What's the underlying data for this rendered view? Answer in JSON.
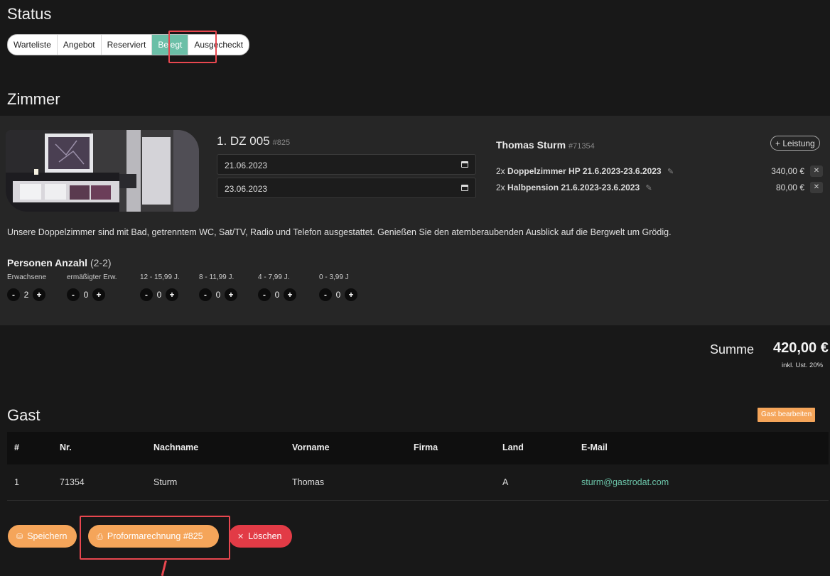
{
  "status": {
    "title": "Status",
    "segments": [
      "Warteliste",
      "Angebot",
      "Reserviert",
      "Belegt",
      "Ausgecheckt"
    ],
    "active": "Belegt",
    "accent": "#6bbfa7"
  },
  "zimmer": {
    "title": "Zimmer",
    "room_name": "1. DZ 005",
    "room_ref": "#825",
    "arrival": "21.06.2023",
    "departure": "23.06.2023",
    "guest_name": "Thomas Sturm",
    "guest_ref": "#71354",
    "add_service_label": "+ Leistung",
    "services": [
      {
        "qty": "2x",
        "title": "Doppelzimmer HP 21.6.2023-23.6.2023",
        "price": "340,00 €"
      },
      {
        "qty": "2x",
        "title": "Halbpension 21.6.2023-23.6.2023",
        "price": "80,00 €"
      }
    ],
    "description": "Unsere Doppelzimmer sind mit Bad, getrenntem WC, Sat/TV, Radio und Telefon ausgestattet. Genießen Sie den atemberaubenden Ausblick auf die Bergwelt um Grödig.",
    "persons_title": "Personen Anzahl",
    "persons_range": "(2-2)",
    "age_groups": [
      {
        "label": "Erwachsene",
        "count": "2"
      },
      {
        "label": "ermäßigter Erw.",
        "count": "0"
      },
      {
        "label": "12 - 15,99 J.",
        "count": "0"
      },
      {
        "label": "8 - 11,99 J.",
        "count": "0"
      },
      {
        "label": "4 - 7,99 J.",
        "count": "0"
      },
      {
        "label": "0 - 3,99 J",
        "count": "0"
      }
    ]
  },
  "summary": {
    "label": "Summe",
    "value": "420,00 €",
    "note": "inkl. Ust. 20%"
  },
  "gast": {
    "title": "Gast",
    "edit_label": "Gast bearbeiten",
    "columns": [
      "#",
      "Nr.",
      "Nachname",
      "Vorname",
      "Firma",
      "Land",
      "E-Mail"
    ],
    "rows": [
      {
        "idx": "1",
        "nr": "71354",
        "nachname": "Sturm",
        "vorname": "Thomas",
        "firma": "",
        "land": "A",
        "email": "sturm@gastrodat.com"
      }
    ]
  },
  "actions": {
    "save_label": "Speichern",
    "proforma_label": "Proformarechnung #825",
    "delete_label": "Löschen"
  },
  "colors": {
    "background": "#181818",
    "panel": "#262626",
    "orange": "#f5a55a",
    "red": "#e23b46",
    "highlight": "#e8474f",
    "email": "#6bc3a8"
  }
}
